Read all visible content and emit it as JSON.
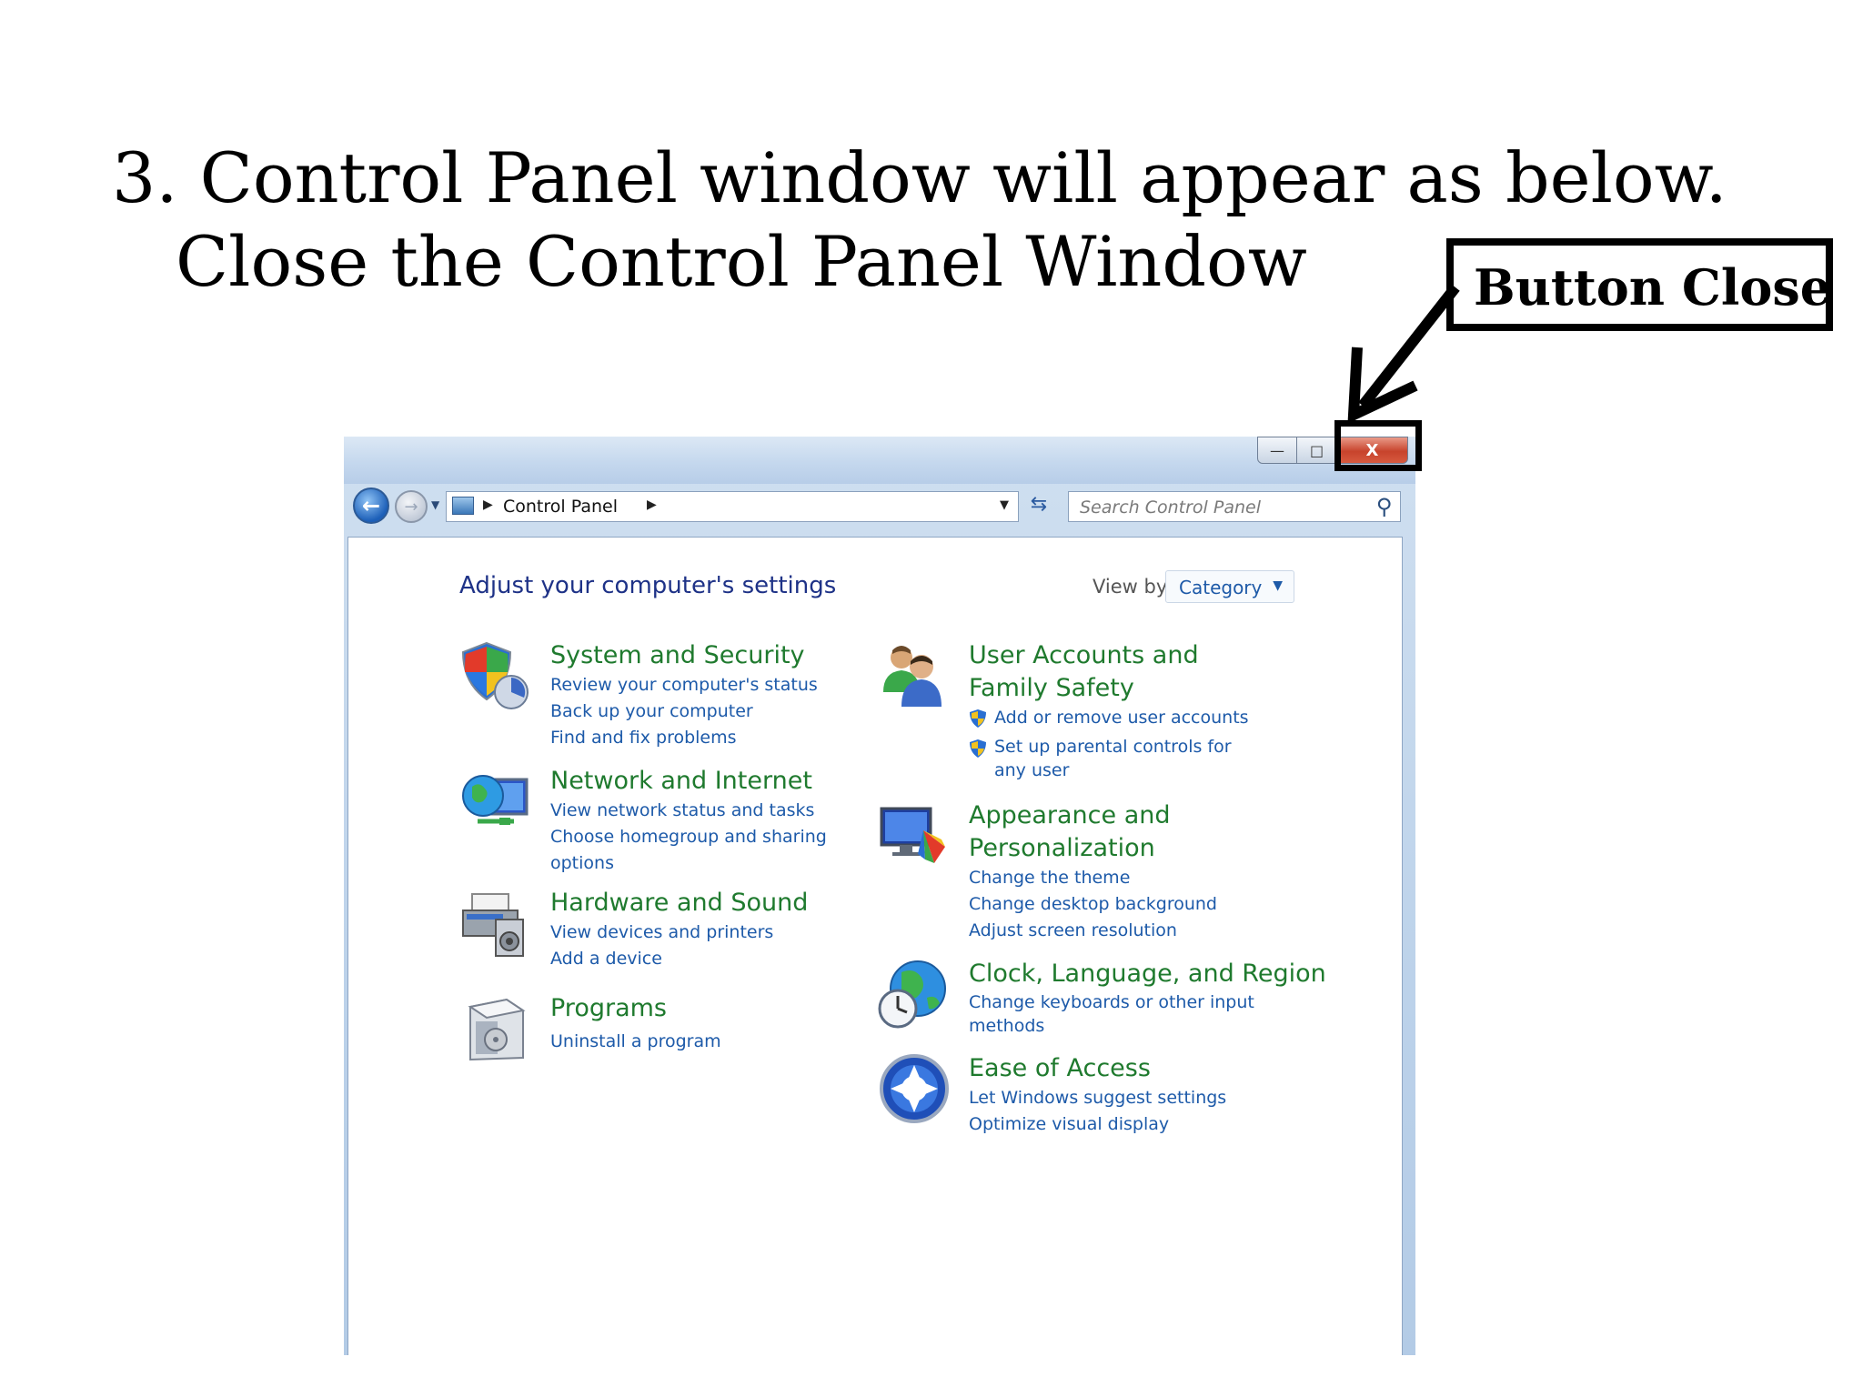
{
  "slide": {
    "title_line1": "3. Control Panel window will appear as below.",
    "title_line2": "Close the Control Panel Window",
    "callout_label": "Button Close"
  },
  "window": {
    "controls": {
      "minimize": "—",
      "maximize": "□",
      "close": "X"
    },
    "address": {
      "breadcrumb": "Control Panel"
    },
    "search": {
      "placeholder": "Search Control Panel"
    },
    "heading": "Adjust your computer's settings",
    "view_by": {
      "label": "View by:",
      "value": "Category"
    },
    "categories_left": [
      {
        "title": "System and Security",
        "links": [
          "Review your computer's status",
          "Back up your computer",
          "Find and fix problems"
        ],
        "icon": "shield-icon"
      },
      {
        "title": "Network and Internet",
        "links": [
          "View network status and tasks",
          "Choose homegroup and sharing options"
        ],
        "icon": "globe-network-icon"
      },
      {
        "title": "Hardware and Sound",
        "links": [
          "View devices and printers",
          "Add a device"
        ],
        "icon": "printer-speaker-icon"
      },
      {
        "title": "Programs",
        "links": [
          "Uninstall a program"
        ],
        "icon": "programs-box-icon"
      }
    ],
    "categories_right": [
      {
        "title": "User Accounts and Family Safety",
        "links": [
          "Add or remove user accounts",
          "Set up parental controls for any user"
        ],
        "icon": "users-icon"
      },
      {
        "title": "Appearance and Personalization",
        "links": [
          "Change the theme",
          "Change desktop background",
          "Adjust screen resolution"
        ],
        "icon": "monitor-palette-icon"
      },
      {
        "title": "Clock, Language, and Region",
        "links": [
          "Change keyboards or other input methods"
        ],
        "icon": "globe-clock-icon"
      },
      {
        "title": "Ease of Access",
        "links": [
          "Let Windows suggest settings",
          "Optimize visual display"
        ],
        "icon": "ease-of-access-icon"
      }
    ]
  }
}
